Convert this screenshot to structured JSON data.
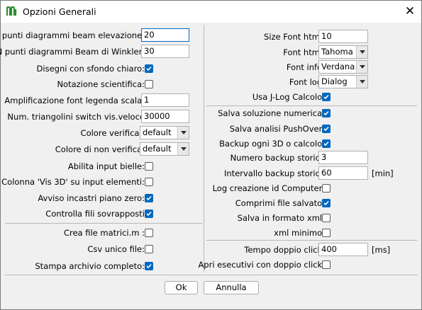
{
  "window": {
    "title": "Opzioni Generali"
  },
  "left": {
    "fields": [
      {
        "label": "N punti diagrammi beam elevazione:",
        "value": "20"
      },
      {
        "label": "N punti diagrammi Beam di Winkler:",
        "value": "30"
      }
    ],
    "disegni": {
      "label": "Disegni con sfondo chiaro:",
      "checked": true
    },
    "notazione": {
      "label": "Notazione scientifica:",
      "checked": false
    },
    "amplificazione": {
      "label": "Amplificazione font legenda scala:",
      "value": "1"
    },
    "triangolini": {
      "label": "Num. triangolini switch vis.veloce",
      "value": "30000"
    },
    "colore_verifica": {
      "label": "Colore verifica :",
      "value": "default"
    },
    "colore_non_verifica": {
      "label": "Colore di non verifica:",
      "value": "default"
    },
    "checks": [
      {
        "label": "Abilita input bielle:",
        "checked": false
      },
      {
        "label": "Colonna 'Vis 3D' su input elementi:",
        "checked": false
      },
      {
        "label": "Avviso incastri piano zero:",
        "checked": true
      },
      {
        "label": "Controlla fili sovrapposti",
        "checked": true
      }
    ],
    "checks2": [
      {
        "label": "Crea file matrici.m :",
        "checked": false
      },
      {
        "label": "Csv unico file:",
        "checked": false
      },
      {
        "label": "Stampa archivio completo:",
        "checked": true
      }
    ]
  },
  "right": {
    "size_font": {
      "label": "Size Font html:",
      "value": "10"
    },
    "font_html": {
      "label": "Font html:",
      "value": "Tahoma"
    },
    "font_info": {
      "label": "Font info:",
      "value": "Verdana"
    },
    "font_log": {
      "label": "Font log:",
      "value": "Dialog"
    },
    "jlog": {
      "label": "Usa J-Log Calcolo:",
      "checked": true
    },
    "checks": [
      {
        "label": "Salva soluzione numerica:",
        "checked": true
      },
      {
        "label": "Salva analisi PushOver:",
        "checked": true
      },
      {
        "label": "Backup ogni 3D o calcolo:",
        "checked": true
      }
    ],
    "numero_backup": {
      "label": "Numero backup storici:",
      "value": "3"
    },
    "intervallo_backup": {
      "label": "Intervallo backup storici:",
      "value": "60",
      "unit": "[min]"
    },
    "checks2": [
      {
        "label": "Log creazione id Computer:",
        "checked": false
      },
      {
        "label": "Comprimi file salvato:",
        "checked": true
      },
      {
        "label": "Salva in formato xml:",
        "checked": false
      },
      {
        "label": "xml minimo:",
        "checked": false
      }
    ],
    "tempo_click": {
      "label": "Tempo doppio click:",
      "value": "400",
      "unit": "[ms]"
    },
    "apri_eseguibili": {
      "label": "Apri esecutivi con doppio click:",
      "checked": false
    }
  },
  "buttons": {
    "ok": "Ok",
    "annulla": "Annulla"
  },
  "colors": {
    "accent": "#0067c0",
    "app_icon": "#2e8b2e"
  }
}
